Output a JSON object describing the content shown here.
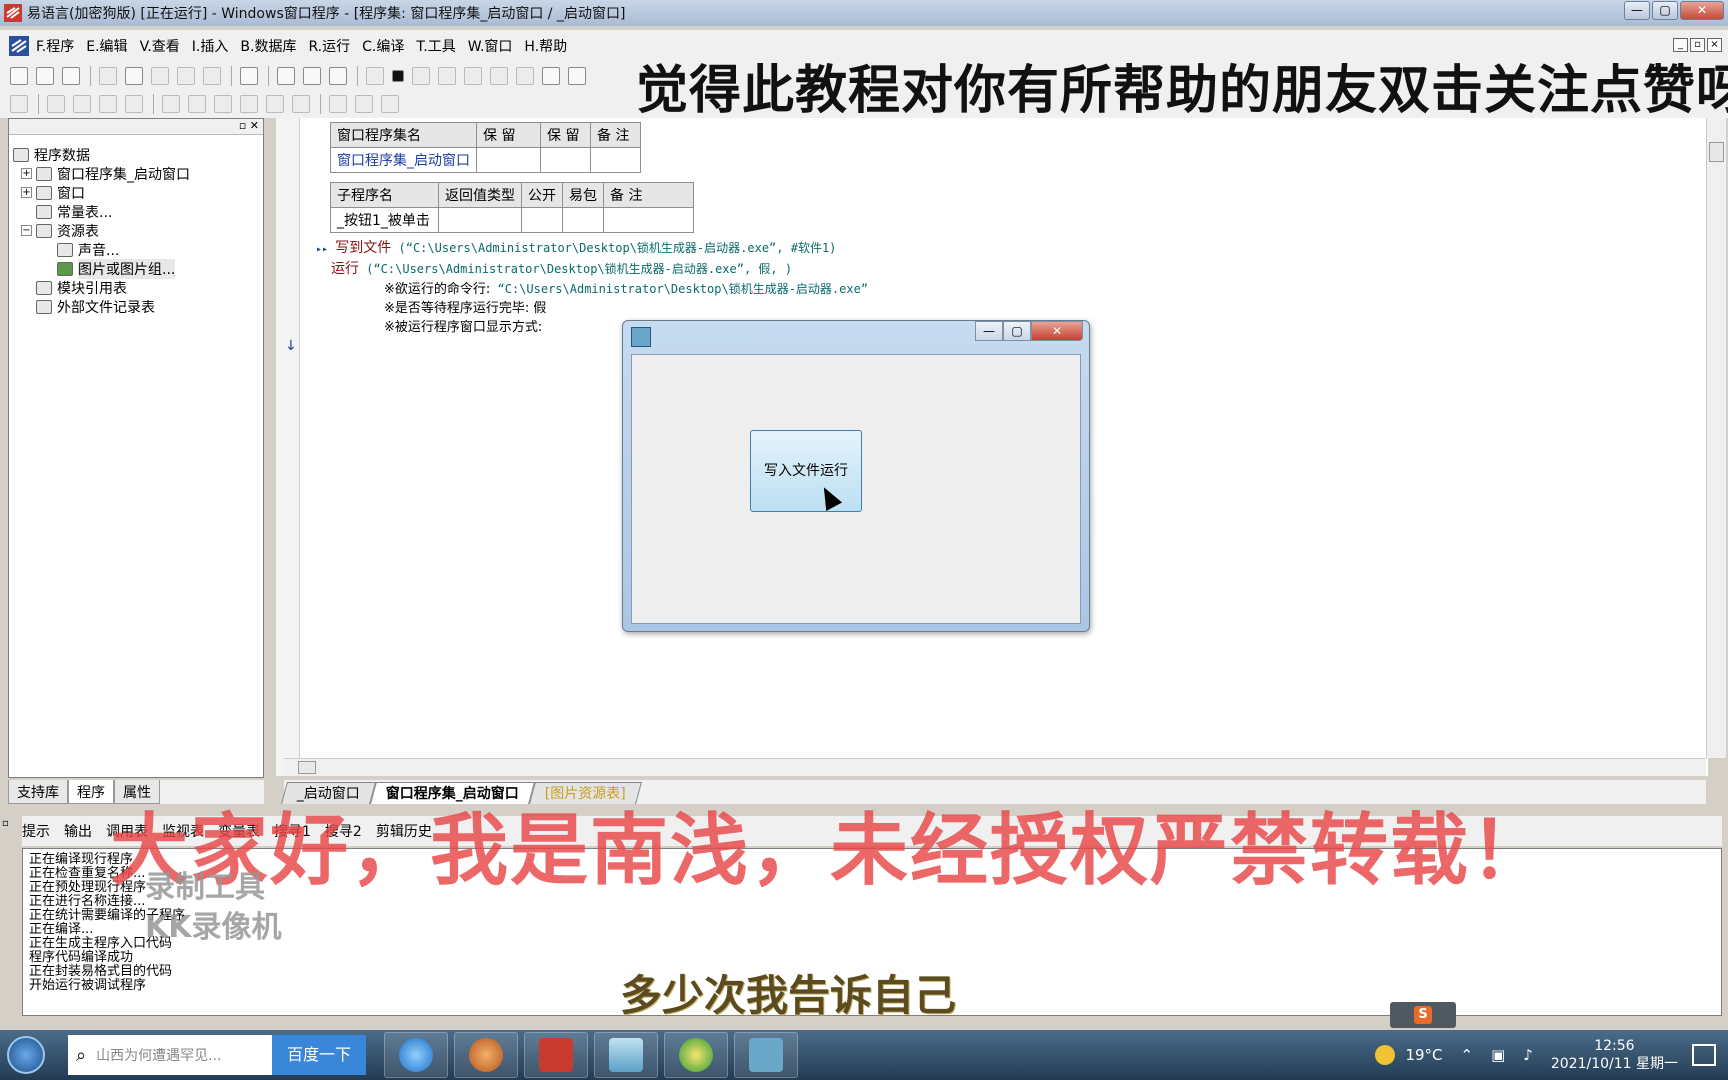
{
  "window": {
    "title": "易语言(加密狗版) [正在运行] - Windows窗口程序 - [程序集: 窗口程序集_启动窗口 / _启动窗口]",
    "min": "—",
    "max": "▢",
    "close": "✕"
  },
  "menu": {
    "items": [
      "F.程序",
      "E.编辑",
      "V.查看",
      "I.插入",
      "B.数据库",
      "R.运行",
      "C.编译",
      "T.工具",
      "W.窗口",
      "H.帮助"
    ],
    "mdi": [
      "_",
      "▫",
      "×"
    ]
  },
  "overlay_top": "觉得此教程对你有所帮助的朋友双击关注点赞呀",
  "tree": {
    "root": "程序数据",
    "items": [
      {
        "label": "窗口程序集_启动窗口",
        "indent": 1,
        "expand": "+"
      },
      {
        "label": "窗口",
        "indent": 1,
        "expand": "+"
      },
      {
        "label": "常量表...",
        "indent": 1,
        "expand": ""
      },
      {
        "label": "资源表",
        "indent": 1,
        "expand": "−"
      },
      {
        "label": "声音...",
        "indent": 2,
        "expand": ""
      },
      {
        "label": "图片或图片组...",
        "indent": 2,
        "expand": ""
      },
      {
        "label": "模块引用表",
        "indent": 1,
        "expand": ""
      },
      {
        "label": "外部文件记录表",
        "indent": 1,
        "expand": ""
      }
    ],
    "panel_btns": "▫ ✕"
  },
  "left_tabs": [
    "支持库",
    "程序",
    "属性"
  ],
  "assembly_table": {
    "headers": [
      "窗口程序集名",
      "保 留",
      "保 留",
      "备 注"
    ],
    "row": [
      "窗口程序集_启动窗口",
      "",
      "",
      ""
    ]
  },
  "sub_table": {
    "headers": [
      "子程序名",
      "返回值类型",
      "公开",
      "易包",
      "备 注"
    ],
    "row": [
      "_按钮1_被单击",
      "",
      "",
      "",
      ""
    ]
  },
  "code": {
    "line1_marker": "▸▸",
    "line1_kw": "写到文件",
    "line1_args": " (“C:\\Users\\Administrator\\Desktop\\锁机生成器-启动器.exe”, #软件1)",
    "line2_kw": "运行",
    "line2_args": " (“C:\\Users\\Administrator\\Desktop\\锁机生成器-启动器.exe”, 假, )",
    "param1_label": "※欲运行的命令行:",
    "param1_value": " “C:\\Users\\Administrator\\Desktop\\锁机生成器-启动器.exe”",
    "param2_label": "※是否等待程序运行完毕:",
    "param2_value": " 假",
    "param3_label": "※被运行程序窗口显示方式:",
    "arrow": "↓"
  },
  "editor_tabs": [
    "_启动窗口",
    "窗口程序集_启动窗口",
    "[图片资源表]"
  ],
  "bottom_toolbar": [
    "提示",
    "输出",
    "调用表",
    "监视表",
    "变量表",
    "搜寻1",
    "搜寻2",
    "剪辑历史"
  ],
  "output_lines": [
    "正在编译现行程序",
    "正在检查重复名称...",
    "正在预处理现行程序",
    "正在进行名称连接...",
    "正在统计需要编译的子程序",
    "正在编译...",
    "正在生成主程序入口代码",
    "程序代码编译成功",
    "正在封装易格式目的代码",
    "开始运行被调试程序"
  ],
  "overlay_red": "大家好，我是南浅，未经授权严禁转载！",
  "watermark": [
    "录制工具",
    "KK录像机"
  ],
  "subtitle": "多少次我告诉自己",
  "dialog": {
    "button_label": "写入文件运行",
    "min": "—",
    "max": "▢",
    "close": "✕"
  },
  "taskbar": {
    "search_placeholder": "山西为何遭遇罕见...",
    "search_button": "百度一下",
    "temperature": "19°C",
    "time": "12:56",
    "date": "2021/10/11 星期一",
    "ime_label": "S"
  },
  "colors": {
    "accent": "#1a3fa0",
    "keyword": "#8b1010",
    "string": "#0a6a6a",
    "overlay_red": "#e84646"
  }
}
